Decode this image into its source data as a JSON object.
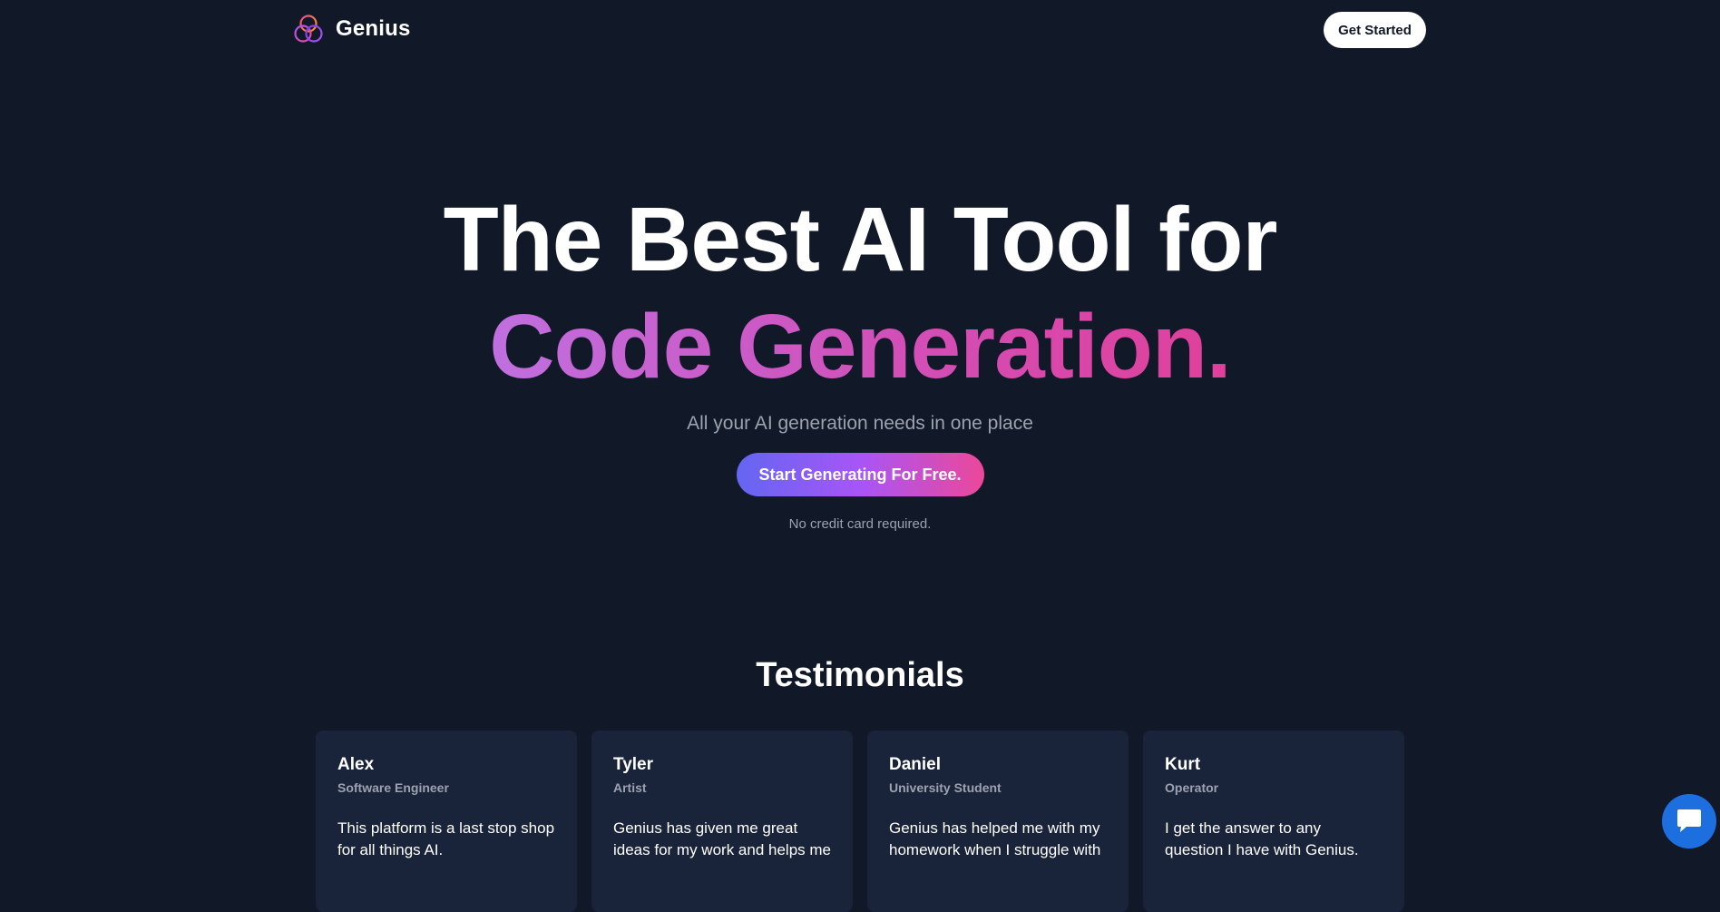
{
  "navbar": {
    "brand_name": "Genius",
    "logo_icon": "genius-trefoil-logo",
    "cta_label": "Get Started"
  },
  "hero": {
    "title_line_1": "The Best AI Tool for",
    "title_line_2": "Code Generation.",
    "subtitle": "All your AI generation needs in one place",
    "cta_label": "Start Generating For Free.",
    "note": "No credit card required."
  },
  "colors": {
    "background": "#111827",
    "card_background": "#192339",
    "gradient_start": "#6366f1",
    "gradient_mid": "#a855f7",
    "gradient_end": "#ec4899",
    "chat_blue": "#1d6fe0"
  },
  "testimonials": {
    "title": "Testimonials",
    "items": [
      {
        "name": "Alex",
        "role": "Software Engineer",
        "text": "This platform is a last stop shop for all things AI."
      },
      {
        "name": "Tyler",
        "role": "Artist",
        "text": "Genius has given me great ideas for my work and helps me"
      },
      {
        "name": "Daniel",
        "role": "University Student",
        "text": "Genius has helped me with my homework when I struggle with"
      },
      {
        "name": "Kurt",
        "role": "Operator",
        "text": "I get the answer to any question I have with Genius."
      }
    ]
  },
  "chat_widget": {
    "icon": "chat-bubble-icon"
  }
}
